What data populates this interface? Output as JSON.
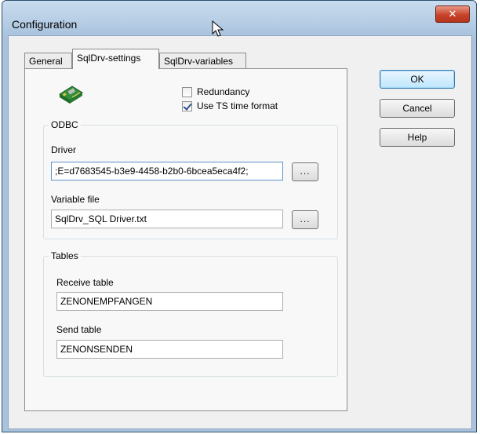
{
  "window": {
    "title": "Configuration",
    "close_glyph": "✕"
  },
  "tabs": [
    {
      "label": "General"
    },
    {
      "label": "SqlDrv-settings"
    },
    {
      "label": "SqlDrv-variables"
    }
  ],
  "buttons": {
    "ok": "OK",
    "cancel": "Cancel",
    "help": "Help"
  },
  "options": {
    "redundancy": {
      "label": "Redundancy",
      "checked": false
    },
    "ts_format": {
      "label": "Use TS time format",
      "checked": true
    }
  },
  "odbc": {
    "title": "ODBC",
    "driver_label": "Driver",
    "driver_value": ";E=d7683545-b3e9-4458-b2b0-6bcea5eca4f2;",
    "variable_label": "Variable file",
    "variable_value": "SqlDrv_SQL Driver.txt",
    "browse_label": "..."
  },
  "tables": {
    "title": "Tables",
    "receive_label": "Receive table",
    "receive_value": "ZENONEMPFANGEN",
    "send_label": "Send table",
    "send_value": "ZENONSENDEN"
  },
  "icons": {
    "driver": "network-card-icon",
    "close": "close-icon"
  }
}
